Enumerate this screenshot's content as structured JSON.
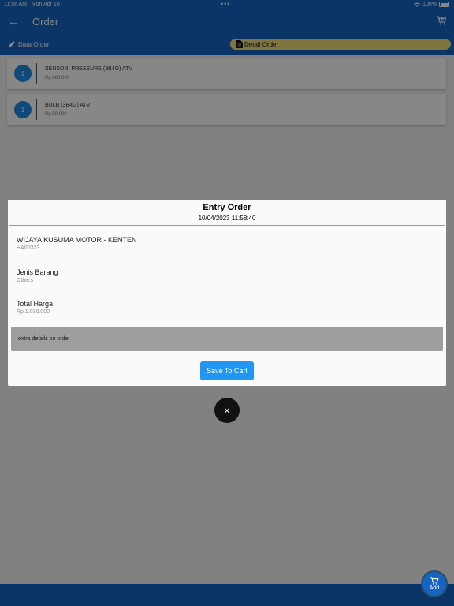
{
  "status_bar": {
    "time": "11:58 AM",
    "date": "Mon Apr 10",
    "battery": "100%"
  },
  "app_bar": {
    "title": "Order"
  },
  "tabs": [
    {
      "label": "Data Order"
    },
    {
      "label": "Detail Order"
    }
  ],
  "order_items": [
    {
      "number": "1",
      "name": "SENSOR, PRESSURE (3B4G) ATV",
      "price": "Rp.980.000"
    },
    {
      "number": "1",
      "name": "BULB (3B4G) ATV",
      "price": "Rp.50.000"
    }
  ],
  "dialog": {
    "title": "Entry Order",
    "datetime": "10/04/2023 11:58:40",
    "customer": {
      "name": "WIJAYA KUSUMA MOTOR - KENTEN",
      "code": "HA00323"
    },
    "item_type": {
      "label": "Jenis Barang",
      "value": "Others"
    },
    "total": {
      "label": "Total Harga",
      "value": "Rp.1.030.000"
    },
    "notes_placeholder": "extra details on order",
    "save_label": "Save To Cart"
  },
  "close_icon": "×",
  "fab": {
    "label": "Add",
    "icon": "cart-add-icon"
  },
  "colors": {
    "primary": "#1565c0",
    "accent_tab": "#f2dc7a",
    "button": "#2196f3"
  }
}
